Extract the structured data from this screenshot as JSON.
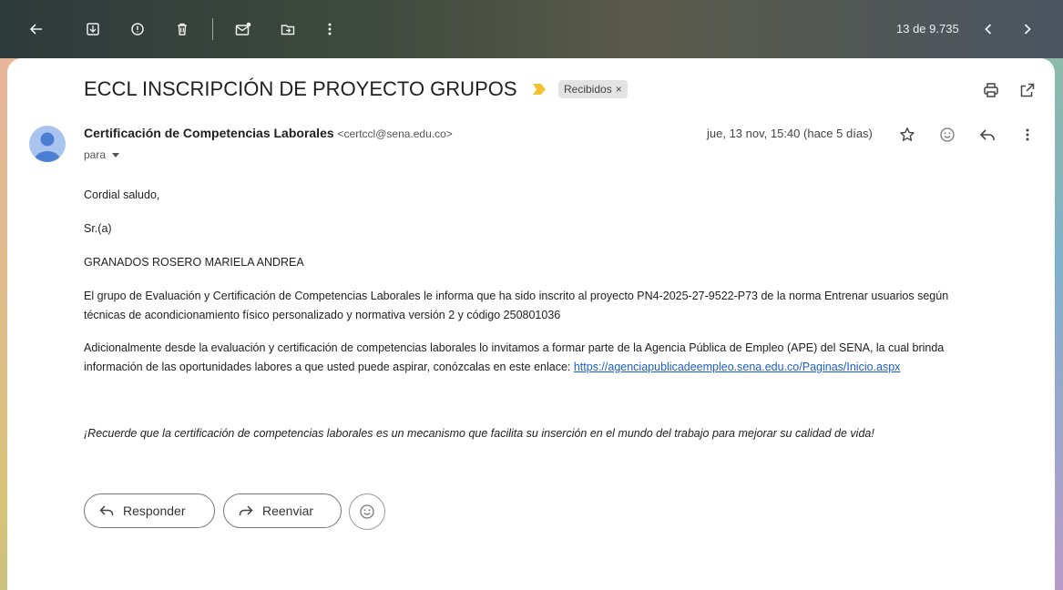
{
  "toolbar": {
    "counter": "13 de 9.735"
  },
  "message": {
    "subject": "ECCL INSCRIPCIÓN DE PROYECTO GRUPOS",
    "label": "Recibidos",
    "label_close": "×",
    "sender_name": "Certificación de Competencias Laborales",
    "sender_email": "<certccl@sena.edu.co>",
    "to": "para",
    "date": "jue, 13 nov, 15:40 (hace 5 días)"
  },
  "body": {
    "greeting": "Cordial saludo,",
    "salutation": "Sr.(a)",
    "recipient": "GRANADOS ROSERO MARIELA ANDREA",
    "p1_line1": "El grupo de Evaluación y Certificación de Competencias Laborales le informa que ha sido inscrito al proyecto PN4-2025-27-9522-P73 de la norma Entrenar usuarios según",
    "p1_line2": "técnicas de acondicionamiento físico personalizado y normativa versión 2 y código 250801036",
    "p2_line1": "Adicionalmente desde la evaluación y certificación de competencias laborales lo invitamos a formar parte de la Agencia Pública de Empleo (APE) del SENA, la cual brinda",
    "p2_line2": "información de las oportunidades labores a que usted puede aspirar, conózcalas en este enlace: ",
    "link": "https://agenciapublicadeempleo.sena.edu.co/Paginas/Inicio.aspx",
    "closing": "¡Recuerde que la certificación de competencias laborales es un mecanismo que facilita su inserción en el mundo del trabajo para mejorar su calidad de vida!"
  },
  "actions": {
    "reply": "Responder",
    "forward": "Reenviar"
  }
}
